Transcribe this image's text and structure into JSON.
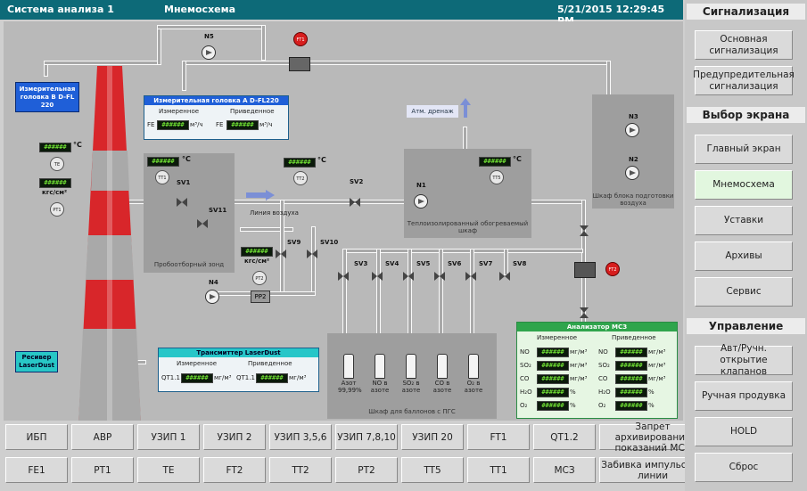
{
  "topbar": {
    "system": "Система анализа 1",
    "screen": "Мнемосхема",
    "datetime": "5/21/2015 12:29:45 PM"
  },
  "right_panel": {
    "signaling_title": "Сигнализация",
    "signaling_buttons": [
      "Основная сигнализация",
      "Предупредительная сигнализация"
    ],
    "screen_select_title": "Выбор экрана",
    "screen_buttons": [
      "Главный экран",
      "Мнемосхема",
      "Уставки",
      "Архивы",
      "Сервис"
    ],
    "active_screen": "Мнемосхема",
    "control_title": "Управление",
    "control_buttons": [
      "Авт/Ручн. открытие клапанов",
      "Ручная продувка",
      "HOLD",
      "Сброс"
    ]
  },
  "bottom_buttons": {
    "row1": [
      "ИБП",
      "АВР",
      "УЗИП 1",
      "УЗИП 2",
      "УЗИП 3,5,6",
      "УЗИП 7,8,10",
      "УЗИП 20",
      "FT1",
      "QT1.2",
      "Запрет архивирования показаний МСЗ"
    ],
    "row2": [
      "FE1",
      "PT1",
      "TE",
      "FT2",
      "TT2",
      "PT2",
      "TT5",
      "TT1",
      "МСЗ",
      "Забивка импульсной линии"
    ]
  },
  "display_value": "######",
  "units": {
    "celsius": "°C",
    "pressure": "кгс/см²",
    "conc": "мг/м³",
    "percent": "%"
  },
  "labels": {
    "meas_head_b": "Измерительная головка B D-FL 220",
    "meas_head_a_title": "Измерительная головка A D-FL220",
    "measured": "Измеренное",
    "reduced": "Приведенное",
    "fe": "FE",
    "fe_unit": "м³/ч",
    "sampling": "Пробоотборный зонд",
    "air_line": "Линия воздуха",
    "drain": "Атм. дренаж",
    "heated_cabinet": "Теплоизолированный обогреваемый шкаф",
    "air_prep_cabinet": "Шкаф блока подготовки воздуха",
    "cylinders_cabinet": "Шкаф для баллонов с ПГС",
    "laserdust_receiver": "Ресивер LaserDust",
    "transmitter_title": "Трансмиттер LaserDust",
    "qt11": "QT1.1",
    "analyzer_title": "Анализатор МСЗ",
    "te": "TE",
    "pt1": "PT1",
    "tt1": "TT1",
    "tt2": "TT2",
    "tt5": "TT5",
    "pt2": "PT2",
    "pp2": "PP2"
  },
  "devices": {
    "pumps": [
      "N5",
      "N4",
      "N1",
      "N3",
      "N2"
    ],
    "valves": [
      "SV1",
      "SV11",
      "SV2",
      "SV9",
      "SV10",
      "SV3",
      "SV4",
      "SV5",
      "SV6",
      "SV7",
      "SV8"
    ],
    "alarms": [
      "FT1",
      "FT2"
    ]
  },
  "analyzer": {
    "rows": [
      {
        "gas": "NO",
        "unit": "мг/м³"
      },
      {
        "gas": "SO₂",
        "unit": "мг/м³"
      },
      {
        "gas": "CO",
        "unit": "мг/м³"
      },
      {
        "gas": "H₂O",
        "unit": "%"
      },
      {
        "gas": "O₂",
        "unit": "%"
      }
    ]
  },
  "cylinders": [
    {
      "label": "Азот 99,99%"
    },
    {
      "label": "NO в азоте"
    },
    {
      "label": "SO₂ в азоте"
    },
    {
      "label": "CO в азоте"
    },
    {
      "label": "O₂ в азоте"
    }
  ],
  "colors": {
    "topbar": "#0d6a78",
    "alarm": "#d71e1e",
    "active_button": "#e2f7df",
    "chimney_red": "#d8262a",
    "header_blue": "#1f5fd8"
  }
}
